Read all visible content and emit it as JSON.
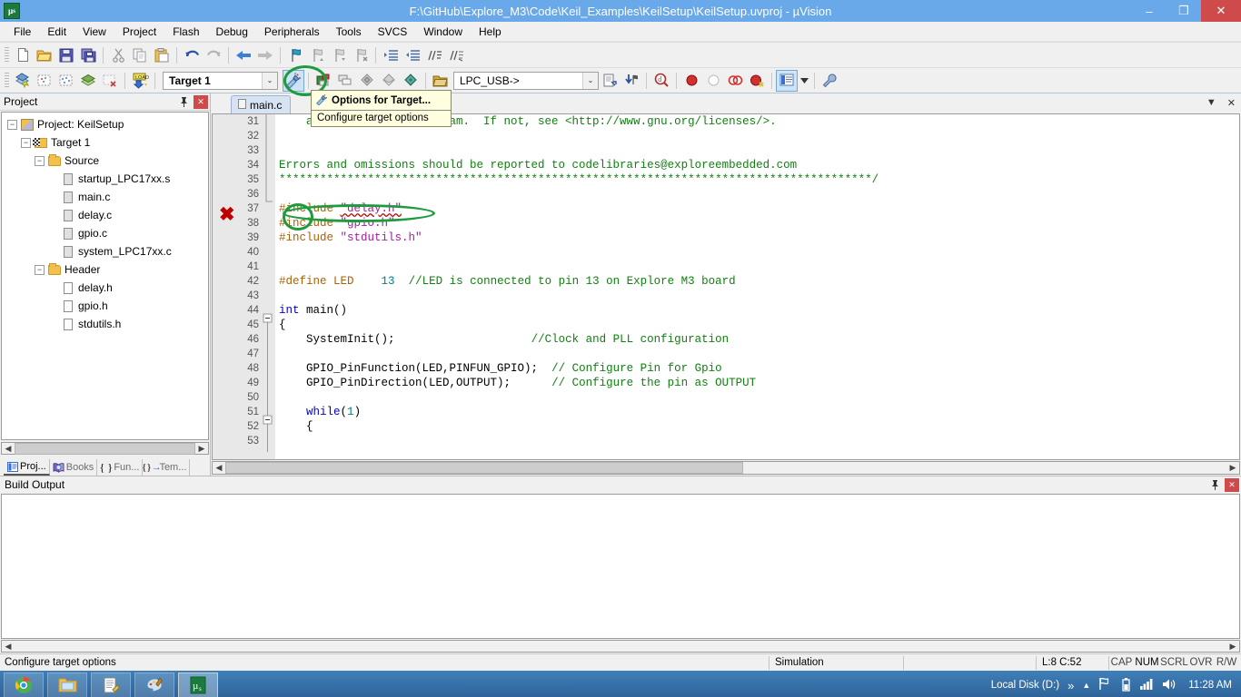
{
  "window": {
    "title": "F:\\GitHub\\Explore_M3\\Code\\Keil_Examples\\KeilSetup\\KeilSetup.uvproj - µVision",
    "app_icon": "uvision-icon",
    "minimize": "–",
    "maximize": "❐",
    "close": "✕"
  },
  "menubar": {
    "items": [
      "File",
      "Edit",
      "View",
      "Project",
      "Flash",
      "Debug",
      "Peripherals",
      "Tools",
      "SVCS",
      "Window",
      "Help"
    ]
  },
  "toolbar1": {
    "icons": [
      "new-file-icon",
      "open-file-icon",
      "save-icon",
      "save-all-icon",
      "cut-icon",
      "copy-icon",
      "paste-icon",
      "undo-icon",
      "redo-icon",
      "navigate-back-icon",
      "navigate-forward-icon",
      "bookmark-toggle-icon",
      "bookmark-prev-icon",
      "bookmark-next-icon",
      "bookmark-clear-icon",
      "indent-icon",
      "outdent-icon",
      "comment-icon",
      "uncomment-icon"
    ]
  },
  "toolbar2": {
    "icons": [
      "build-icon",
      "rebuild-icon",
      "batch-build-icon",
      "translate-icon",
      "stop-build-icon",
      "download-icon"
    ],
    "target_combo": {
      "value": "Target 1",
      "arrow": "⌄"
    },
    "options_for_target": "options-for-target-icon",
    "manage_components": "manage-project-items-icon",
    "multi_project": "multi-project-icon",
    "icons_right": [
      "rtx-kernel-icon",
      "pack-installer-icon",
      "configuration-wizard-icon"
    ],
    "device_combo": {
      "value": "LPC_USB->",
      "arrow": "⌄"
    },
    "right_icons": [
      "file-view-icon",
      "insert-tracepoint-icon",
      "find-in-files-icon",
      "breakpoint-icon",
      "disable-breakpoint-icon",
      "kill-all-breakpoints-icon",
      "enable-disable-breakpoints-icon",
      "window-list-icon",
      "dropdown-arrow-icon",
      "customize-tools-icon"
    ]
  },
  "tooltip": {
    "title": "Options for Target...",
    "subtitle": "Configure target options",
    "icon": "options-for-target-icon"
  },
  "project_pane": {
    "header": "Project",
    "pin": "pin-icon",
    "close": "✕",
    "tree": [
      {
        "depth": 0,
        "label": "Project: KeilSetup",
        "icon": "project-icon",
        "expander": "−"
      },
      {
        "depth": 1,
        "label": "Target 1",
        "icon": "target-icon",
        "expander": "−"
      },
      {
        "depth": 2,
        "label": "Source",
        "icon": "folder-icon",
        "expander": "−"
      },
      {
        "depth": 3,
        "label": "startup_LPC17xx.s",
        "icon": "source-file-icon",
        "expander": ""
      },
      {
        "depth": 3,
        "label": "main.c",
        "icon": "source-file-icon",
        "expander": ""
      },
      {
        "depth": 3,
        "label": "delay.c",
        "icon": "source-file-icon",
        "expander": ""
      },
      {
        "depth": 3,
        "label": "gpio.c",
        "icon": "source-file-icon",
        "expander": ""
      },
      {
        "depth": 3,
        "label": "system_LPC17xx.c",
        "icon": "source-file-icon",
        "expander": ""
      },
      {
        "depth": 2,
        "label": "Header",
        "icon": "folder-icon",
        "expander": "−"
      },
      {
        "depth": 3,
        "label": "delay.h",
        "icon": "header-file-icon",
        "expander": ""
      },
      {
        "depth": 3,
        "label": "gpio.h",
        "icon": "header-file-icon",
        "expander": ""
      },
      {
        "depth": 3,
        "label": "stdutils.h",
        "icon": "header-file-icon",
        "expander": ""
      }
    ],
    "tabs": [
      {
        "label": "Proj...",
        "icon": "project-tab-icon",
        "selected": true
      },
      {
        "label": "Books",
        "icon": "books-tab-icon",
        "selected": false
      },
      {
        "label": "Fun...",
        "icon": "functions-tab-icon",
        "selected": false
      },
      {
        "label": "Tem...",
        "icon": "templates-tab-icon",
        "selected": false
      }
    ]
  },
  "editor": {
    "tabs": [
      {
        "label": "main.c",
        "icon": "source-file-icon",
        "active": true
      }
    ],
    "window_list_icon": "▼",
    "close_icon": "✕",
    "first_line_number": 31,
    "lines": [
      {
        "n": 31,
        "tokens": [
          {
            "t": "    along with this program.  If not, see <http://www.gnu.org/licenses/>.",
            "c": "cmt"
          }
        ]
      },
      {
        "n": 32,
        "tokens": []
      },
      {
        "n": 33,
        "tokens": []
      },
      {
        "n": 34,
        "tokens": [
          {
            "t": "Errors and omissions should be reported to codelibraries@exploreembedded.com",
            "c": "cmt"
          }
        ]
      },
      {
        "n": 35,
        "tokens": [
          {
            "t": "***************************************************************************************/",
            "c": "cmt"
          }
        ]
      },
      {
        "n": 36,
        "tokens": []
      },
      {
        "n": 37,
        "tokens": [
          {
            "t": "#include ",
            "c": "pp"
          },
          {
            "t": "\"delay.h\"",
            "c": "str"
          }
        ],
        "marker": "error"
      },
      {
        "n": 38,
        "tokens": [
          {
            "t": "#include ",
            "c": "pp"
          },
          {
            "t": "\"gpio.h\"",
            "c": "str"
          }
        ]
      },
      {
        "n": 39,
        "tokens": [
          {
            "t": "#include ",
            "c": "pp"
          },
          {
            "t": "\"stdutils.h\"",
            "c": "str"
          }
        ]
      },
      {
        "n": 40,
        "tokens": []
      },
      {
        "n": 41,
        "tokens": []
      },
      {
        "n": 42,
        "tokens": [
          {
            "t": "#define LED",
            "c": "pp"
          },
          {
            "t": "    ",
            "c": "fn"
          },
          {
            "t": "13",
            "c": "num"
          },
          {
            "t": "  ",
            "c": "fn"
          },
          {
            "t": "//LED is connected to pin 13 on Explore M3 board",
            "c": "cmt"
          }
        ]
      },
      {
        "n": 43,
        "tokens": []
      },
      {
        "n": 44,
        "tokens": [
          {
            "t": "int ",
            "c": "kw"
          },
          {
            "t": "main()",
            "c": "fn"
          }
        ]
      },
      {
        "n": 45,
        "tokens": [
          {
            "t": "{",
            "c": "fn"
          }
        ],
        "fold": "−"
      },
      {
        "n": 46,
        "tokens": [
          {
            "t": "    SystemInit();",
            "c": "fn"
          },
          {
            "t": "                    ",
            "c": "fn"
          },
          {
            "t": "//Clock and PLL configuration",
            "c": "cmt"
          }
        ]
      },
      {
        "n": 47,
        "tokens": []
      },
      {
        "n": 48,
        "tokens": [
          {
            "t": "    GPIO_PinFunction(LED,PINFUN_GPIO);  ",
            "c": "fn"
          },
          {
            "t": "// Configure Pin for Gpio",
            "c": "cmt"
          }
        ]
      },
      {
        "n": 49,
        "tokens": [
          {
            "t": "    GPIO_PinDirection(LED,OUTPUT);      ",
            "c": "fn"
          },
          {
            "t": "// Configure the pin as OUTPUT",
            "c": "cmt"
          }
        ]
      },
      {
        "n": 50,
        "tokens": []
      },
      {
        "n": 51,
        "tokens": [
          {
            "t": "    ",
            "c": "fn"
          },
          {
            "t": "while",
            "c": "kw"
          },
          {
            "t": "(",
            "c": "fn"
          },
          {
            "t": "1",
            "c": "num"
          },
          {
            "t": ")",
            "c": "fn"
          }
        ]
      },
      {
        "n": 52,
        "tokens": [
          {
            "t": "    {",
            "c": "fn"
          }
        ],
        "fold": "−"
      },
      {
        "n": 53,
        "tokens": []
      }
    ]
  },
  "build_output": {
    "header": "Build Output",
    "pin": "pin-icon",
    "close": "✕",
    "content": ""
  },
  "statusbar": {
    "message": "Configure target options",
    "simulation": "Simulation",
    "blank": "",
    "cursor": "L:8 C:52",
    "flags": [
      {
        "label": "CAP",
        "on": false
      },
      {
        "label": "NUM",
        "on": true
      },
      {
        "label": "SCRL",
        "on": false
      },
      {
        "label": "OVR",
        "on": false
      },
      {
        "label": "R/W",
        "on": false
      }
    ]
  },
  "taskbar": {
    "apps": [
      {
        "name": "chrome-taskbar-icon",
        "selected": false
      },
      {
        "name": "file-explorer-taskbar-icon",
        "selected": false
      },
      {
        "name": "notepad-taskbar-icon",
        "selected": false
      },
      {
        "name": "paint-taskbar-icon",
        "selected": false
      },
      {
        "name": "uvision-taskbar-icon",
        "selected": true
      }
    ],
    "tray_label": "Local Disk (D:)",
    "tray_overflow": "»",
    "tray_expand": "▲",
    "tray_icons": [
      "action-center-icon",
      "battery-icon",
      "network-icon",
      "volume-icon"
    ],
    "clock": "11:28 AM"
  },
  "annotations": {
    "toolbar_circle": "options-for-target-highlight",
    "code_circle": "include-delay-highlight",
    "error_x": "✖"
  },
  "colors": {
    "titlebar": "#6aa9e9",
    "close_button": "#cf4b4b",
    "annotation_green": "#1f9b3f",
    "annotation_red": "#c00000",
    "comment_green": "#108010",
    "keyword_blue": "#0000d0",
    "string_purple": "#a020a0",
    "preproc_orange": "#b06000",
    "taskbar_blue": "#2d6196"
  }
}
